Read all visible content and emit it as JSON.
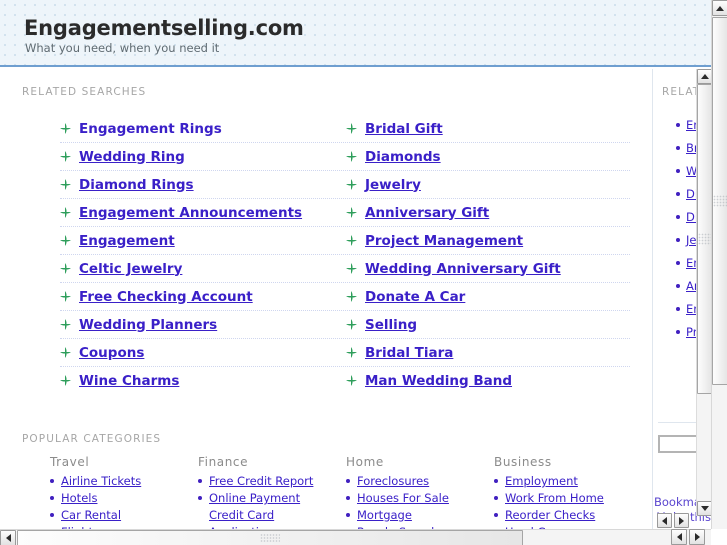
{
  "header": {
    "title": "Engagementselling.com",
    "tagline": "What you need, when you need it"
  },
  "related": {
    "label": "RELATED SEARCHES",
    "rows": [
      {
        "left": "Engagement Rings",
        "right": "Bridal Gift"
      },
      {
        "left": "Wedding Ring",
        "right": "Diamonds"
      },
      {
        "left": "Diamond Rings",
        "right": "Jewelry"
      },
      {
        "left": "Engagement Announcements",
        "right": "Anniversary Gift"
      },
      {
        "left": "Engagement",
        "right": "Project Management"
      },
      {
        "left": "Celtic Jewelry",
        "right": "Wedding Anniversary Gift"
      },
      {
        "left": "Free Checking Account",
        "right": "Donate A Car"
      },
      {
        "left": "Wedding Planners",
        "right": "Selling"
      },
      {
        "left": "Coupons",
        "right": "Bridal Tiara"
      },
      {
        "left": "Wine Charms",
        "right": "Man Wedding Band"
      }
    ]
  },
  "popular": {
    "label": "POPULAR CATEGORIES",
    "columns": [
      {
        "title": "Travel",
        "items": [
          {
            "text": "Airline Tickets",
            "bullet": true
          },
          {
            "text": "Hotels",
            "bullet": true
          },
          {
            "text": "Car Rental",
            "bullet": true
          },
          {
            "text": "Flights",
            "bullet": true
          }
        ]
      },
      {
        "title": "Finance",
        "items": [
          {
            "text": "Free Credit Report",
            "bullet": true
          },
          {
            "text": "Online Payment",
            "bullet": true
          },
          {
            "text": "Credit Card",
            "bullet": false
          },
          {
            "text": "Application",
            "bullet": true
          }
        ]
      },
      {
        "title": "Home",
        "items": [
          {
            "text": "Foreclosures",
            "bullet": true
          },
          {
            "text": "Houses For Sale",
            "bullet": true
          },
          {
            "text": "Mortgage",
            "bullet": true
          },
          {
            "text": "People Search",
            "bullet": true
          }
        ]
      },
      {
        "title": "Business",
        "items": [
          {
            "text": "Employment",
            "bullet": true
          },
          {
            "text": "Work From Home",
            "bullet": true
          },
          {
            "text": "Reorder Checks",
            "bullet": true
          },
          {
            "text": "Used Cars",
            "bullet": true
          }
        ]
      }
    ]
  },
  "sidebar": {
    "label": "RELATED",
    "items": [
      "Engagement Rings",
      "Bridal Gift",
      "Wedding Ring",
      "Diamonds",
      "Diamond Rings",
      "Jewelry",
      "Engagement Announcements",
      "Anniversary Gift",
      "Engagement",
      "Project Management"
    ],
    "search_value": "",
    "search_placeholder": "",
    "bookmark_line1": "Bookmark",
    "bookmark_line2": "Make this"
  },
  "colors": {
    "link": "#3a20c8",
    "bullet_green": "#2e9e5b",
    "header_bg": "#eef5fa",
    "header_rule": "#6f9fd0",
    "label_gray": "#a6a6a6"
  }
}
